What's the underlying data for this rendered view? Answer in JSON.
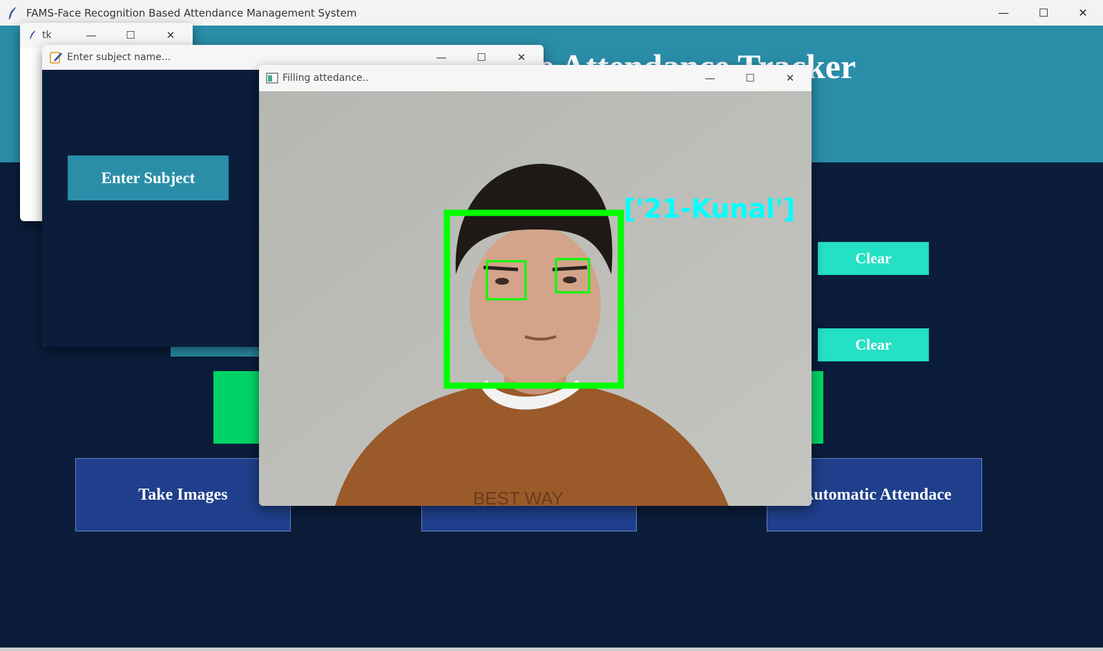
{
  "main_window": {
    "title": "FAMS-Face Recognition Based Attendance Management System",
    "controls": {
      "minimize": "—",
      "maximize": "☐",
      "close": "✕"
    },
    "header_title": "e Attendance Tracker",
    "clear_buttons": [
      "Clear",
      "Clear"
    ],
    "bottom_buttons": {
      "take_images": "Take Images",
      "middle": "",
      "automatic": "Automatic Attendace"
    }
  },
  "tk_window": {
    "title": "tk"
  },
  "subject_window": {
    "title": "Enter subject name...",
    "enter_subject_label": "Enter Subject"
  },
  "camera_window": {
    "title": "Filling attedance..",
    "recognized_label": "['21-Kunal']",
    "shirt_text": "BEST WAY"
  },
  "colors": {
    "background": "#0b1d3a",
    "header": "#2a8ea9",
    "clear_button": "#24e0c4",
    "green_block": "#00d466",
    "action_button": "#1f3f8c",
    "face_box": "#00ff00",
    "label": "#00ffff"
  },
  "icons": {
    "app": "feather-icon",
    "subject": "notepad-icon",
    "camera": "image-window-icon"
  }
}
